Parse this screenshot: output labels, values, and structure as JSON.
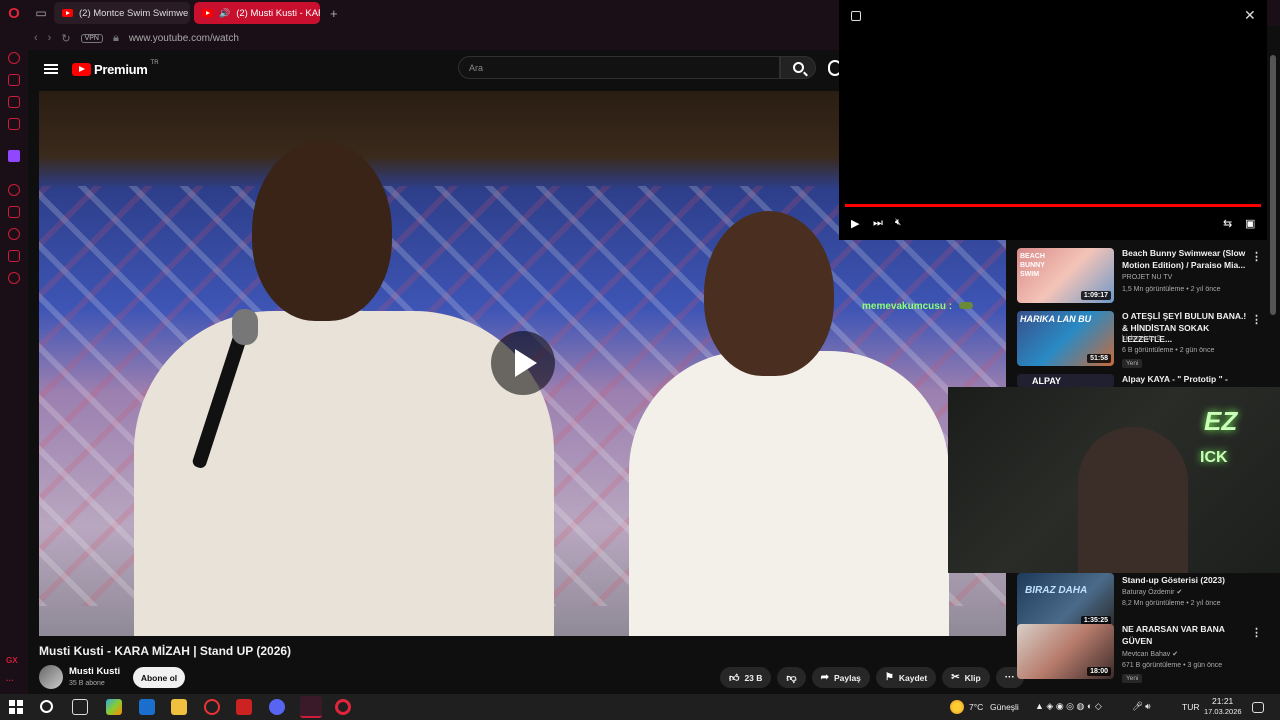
{
  "browser": {
    "tabs": [
      {
        "label": "(2) Montce Swim Swimwe"
      },
      {
        "label": "(2) Musti Kusti - KARA"
      }
    ],
    "vpn_badge": "VPN",
    "url": "www.youtube.com/watch",
    "sidebar_gx": "GX"
  },
  "header": {
    "logo_text": "Premium",
    "logo_region": "TR",
    "search_placeholder": "Ara"
  },
  "video": {
    "title": "Musti Kusti - KARA MİZAH  | Stand UP (2026)",
    "channel": "Musti Kusti",
    "subscribers": "35 B abone",
    "subscribe_label": "Abone ol",
    "likes": "23 B",
    "share_label": "Paylaş",
    "save_label": "Kaydet",
    "clip_label": "Klip"
  },
  "recommendations": [
    {
      "title": "Beach Bunny Swimwear (Slow Motion Edition) / Paraiso Mia...",
      "channel": "PROJET NU TV",
      "meta": "1,5 Mn görüntüleme • 2 yıl önce",
      "duration": "1:09:17",
      "new": "",
      "thumb_text": "BEACH BUNNY SWIM"
    },
    {
      "title": "O ATEŞLİ ŞEYİ BULUN BANA.! & HİNDİSTAN SOKAK LEZZETLE...",
      "channel": "kickmeister5",
      "meta": "6 B görüntüleme • 2 gün önce",
      "duration": "51:58",
      "new": "Yeni",
      "thumb_text": "HARIKA LAN BU"
    },
    {
      "title": "Alpay KAYA - \" Prototip \" -",
      "channel": "",
      "meta": "",
      "duration": "",
      "new": "",
      "thumb_text": "ALPAY"
    },
    {
      "title": "Stand-up Gösterisi (2023)",
      "channel": "Baturay Özdemir",
      "meta": "8,2 Mn görüntüleme • 2 yıl önce",
      "duration": "1:35:25",
      "new": "",
      "thumb_text": "BIRAZ DAHA"
    },
    {
      "title": "NE ARARSAN VAR BANA GÜVEN",
      "channel": "Mevtcan Bahav",
      "meta": "671 B görüntüleme • 3 gün önce",
      "duration": "18:00",
      "new": "Yeni",
      "thumb_text": ""
    }
  ],
  "pip": {
    "progress": 1.0
  },
  "overlay": {
    "chat_message": "memevakumcusu :",
    "webcam_text": "EZ",
    "webcam_text2": "ICK"
  },
  "taskbar": {
    "weather": "7°C",
    "weather_desc": "Güneşli",
    "lang": "TUR",
    "time": "21:21",
    "date": "17.03.2026"
  },
  "colors": {
    "accent": "#ff0000",
    "opera_red": "#d01c3c",
    "bg": "#0f0f0f"
  }
}
